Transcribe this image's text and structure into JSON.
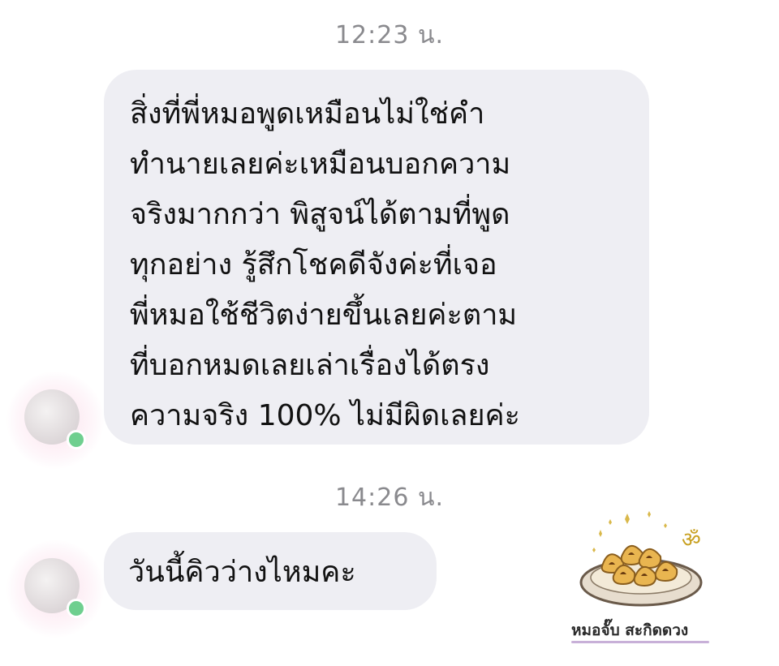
{
  "chat": {
    "messages": [
      {
        "timestamp": "12:23 น.",
        "lines": [
          "สิ่งที่พี่หมอพูดเหมือนไม่ใช่คำ",
          "ทำนายเลยค่ะเหมือนบอกความ",
          "จริงมากกว่า พิสูจน์ได้ตามที่พูด",
          "ทุกอย่าง รู้สึกโชคดีจังค่ะที่เจอ",
          "พี่หมอใช้ชีวิตง่ายขึ้นเลยค่ะตาม",
          "ที่บอกหมดเลยเล่าเรื่องได้ตรง",
          "ความจริง 100% ไม่มีผิดเลยค่ะ"
        ]
      },
      {
        "timestamp": "14:26 น.",
        "text": "วันนี้คิวว่างไหมคะ"
      }
    ]
  },
  "watermark": {
    "text": "หมอจั๊บ สะกิดดวง"
  },
  "colors": {
    "bubble": "#eeeef3",
    "timestamp": "#8a8a8e",
    "online": "#6fcf8f"
  }
}
